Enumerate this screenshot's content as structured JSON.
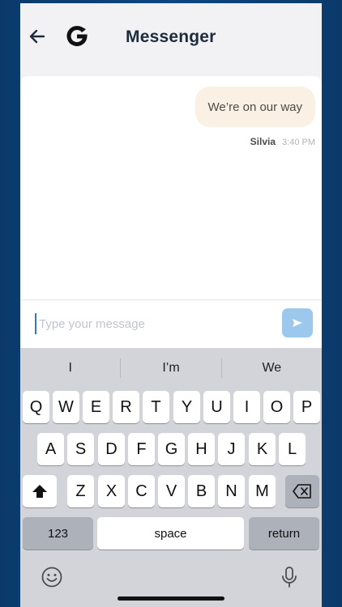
{
  "header": {
    "title": "Messenger",
    "back_icon": "arrow-left-icon",
    "logo_icon": "g-logo-icon"
  },
  "messages": [
    {
      "text": "We’re on our way",
      "sender": "Silvia",
      "time": "3:40 PM"
    }
  ],
  "composer": {
    "placeholder": "Type your message",
    "send_icon": "paper-plane-icon"
  },
  "keyboard": {
    "suggestions": [
      "I",
      "I’m",
      "We"
    ],
    "row1": [
      "Q",
      "W",
      "E",
      "R",
      "T",
      "Y",
      "U",
      "I",
      "O",
      "P"
    ],
    "row2": [
      "A",
      "S",
      "D",
      "F",
      "G",
      "H",
      "J",
      "K",
      "L"
    ],
    "row3": [
      "Z",
      "X",
      "C",
      "V",
      "B",
      "N",
      "M"
    ],
    "numbers_label": "123",
    "space_label": "space",
    "return_label": "return",
    "shift_icon": "shift-icon",
    "delete_icon": "backspace-icon",
    "emoji_icon": "emoji-icon",
    "mic_icon": "microphone-icon"
  },
  "colors": {
    "bubble": "#fbf0e4",
    "send_button": "#9cc8ee",
    "backdrop": "#0d4780"
  }
}
